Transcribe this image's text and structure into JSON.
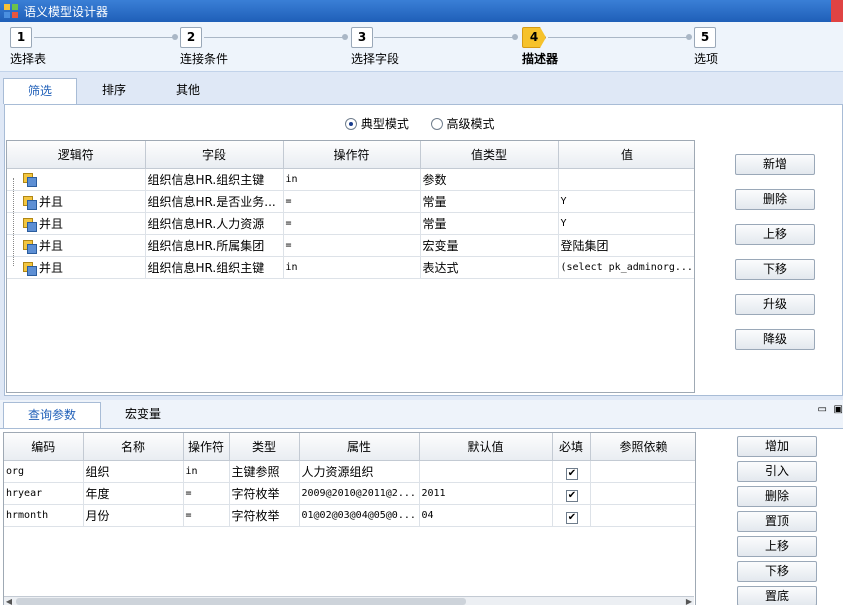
{
  "window": {
    "title": "语义模型设计器"
  },
  "steps": [
    {
      "num": "1",
      "label": "选择表"
    },
    {
      "num": "2",
      "label": "连接条件"
    },
    {
      "num": "3",
      "label": "选择字段"
    },
    {
      "num": "4",
      "label": "描述器"
    },
    {
      "num": "5",
      "label": "选项"
    }
  ],
  "filter_tabs": [
    "筛选",
    "排序",
    "其他"
  ],
  "mode": {
    "typical": "典型模式",
    "advanced": "高级模式",
    "selected": "typical"
  },
  "condition_grid": {
    "headers": [
      "逻辑符",
      "字段",
      "操作符",
      "值类型",
      "值"
    ],
    "rows": [
      {
        "logic": "",
        "field": "组织信息HR.组织主键",
        "op": "in",
        "valtype": "参数",
        "value": ""
      },
      {
        "logic": "并且",
        "field": "组织信息HR.是否业务...",
        "op": "=",
        "valtype": "常量",
        "value": "Y"
      },
      {
        "logic": "并且",
        "field": "组织信息HR.人力资源",
        "op": "=",
        "valtype": "常量",
        "value": "Y"
      },
      {
        "logic": "并且",
        "field": "组织信息HR.所属集团",
        "op": "=",
        "valtype": "宏变量",
        "value": "登陆集团"
      },
      {
        "logic": "并且",
        "field": "组织信息HR.组织主键",
        "op": "in",
        "valtype": "表达式",
        "value": "(select pk_adminorg..."
      }
    ]
  },
  "condition_buttons": [
    "新增",
    "删除",
    "上移",
    "下移",
    "升级",
    "降级"
  ],
  "lower_tabs": [
    "查询参数",
    "宏变量"
  ],
  "param_grid": {
    "headers": [
      "编码",
      "名称",
      "操作符",
      "类型",
      "属性",
      "默认值",
      "必填",
      "参照依赖"
    ],
    "rows": [
      {
        "code": "org",
        "name": "组织",
        "op": "in",
        "type": "主键参照",
        "attr": "人力资源组织",
        "default": "",
        "required": "✔",
        "ref": ""
      },
      {
        "code": "hryear",
        "name": "年度",
        "op": "=",
        "type": "字符枚举",
        "attr": "2009@2010@2011@2...",
        "default": "2011",
        "required": "✔",
        "ref": ""
      },
      {
        "code": "hrmonth",
        "name": "月份",
        "op": "=",
        "type": "字符枚举",
        "attr": "01@02@03@04@05@0...",
        "default": "04",
        "required": "✔",
        "ref": ""
      }
    ]
  },
  "param_buttons": [
    "增加",
    "引入",
    "删除",
    "置顶",
    "上移",
    "下移",
    "置底"
  ],
  "colors": {
    "accent": "#1f5fb8",
    "active_step": "#f6c22b"
  }
}
